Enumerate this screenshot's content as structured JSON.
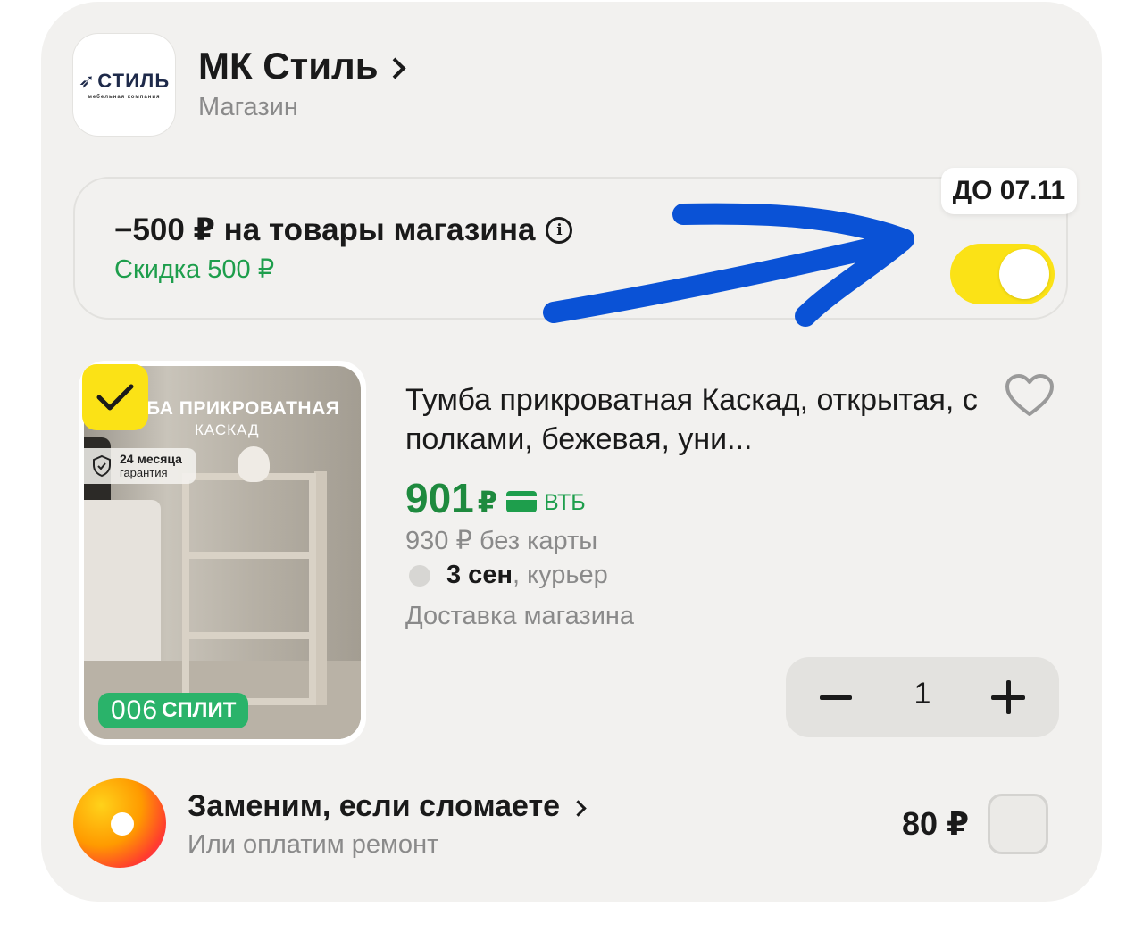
{
  "shop": {
    "logo_text": "СТИЛЬ",
    "logo_subtext": "мебельная компания",
    "name": "МК Стиль",
    "type": "Магазин"
  },
  "promo": {
    "title": "−500 ₽ на товары магазина",
    "discount": "Скидка 500 ₽",
    "deadline": "ДО 07.11",
    "toggle_on": true,
    "toggle_color": "#fbe216",
    "annotation": "blue hand-drawn arrow pointing at toggle"
  },
  "product": {
    "image_title": "БА ПРИКРОВАТНАЯ",
    "image_subtitle": "КАСКАД",
    "warranty_line1": "24 месяца",
    "warranty_line2": "гарантия",
    "split_number": "006",
    "split_label": "СПЛИТ",
    "selected": true,
    "title": "Тумба прикроватная Каскад, открытая, с полками, бежевая, уни...",
    "price": "901",
    "currency": "₽",
    "bank": "ВТБ",
    "price_without_card": "930 ₽ без карты",
    "delivery_date": "3 сен",
    "delivery_method": ", курьер",
    "delivery_note": "Доставка магазина",
    "quantity": "1"
  },
  "insurance": {
    "title": "Заменим, если сломаете",
    "subtitle": "Или оплатим ремонт",
    "price": "80 ₽",
    "selected": false
  },
  "colors": {
    "accent_yellow": "#fbe216",
    "price_green": "#1e8a3e",
    "arrow_blue": "#0a52d6"
  }
}
